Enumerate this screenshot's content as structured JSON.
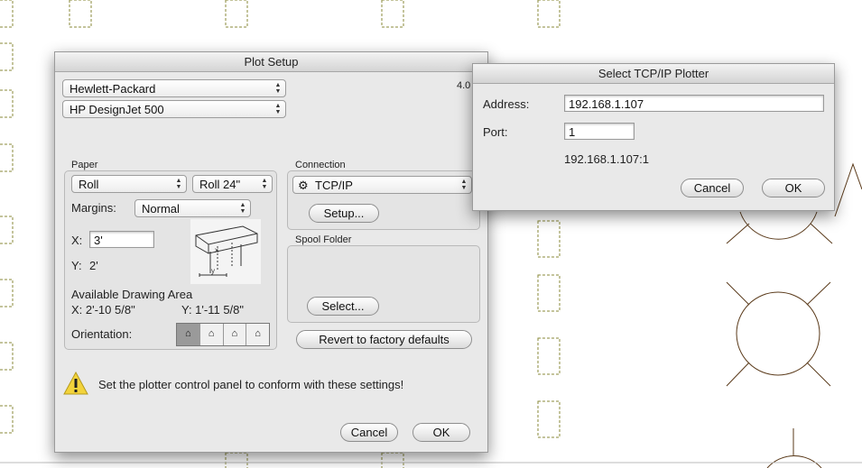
{
  "plot_setup": {
    "title": "Plot Setup",
    "manufacturer": "Hewlett-Packard",
    "model": "HP DesignJet 500",
    "version": "4.0",
    "paper": {
      "label": "Paper",
      "source": "Roll",
      "size": "Roll 24\"",
      "margins_label": "Margins:",
      "margins_value": "Normal",
      "x_label": "X:",
      "x_value": "3'",
      "y_label": "Y:",
      "y_value": "2'",
      "diagram_x": "x",
      "diagram_y": "y"
    },
    "drawing_area": {
      "label": "Available Drawing Area",
      "x": "X:  2'-10 5/8\"",
      "y": "Y:  1'-11 5/8\""
    },
    "orientation_label": "Orientation:",
    "connection": {
      "label": "Connection",
      "type": "TCP/IP",
      "setup_button": "Setup..."
    },
    "spool": {
      "label": "Spool Folder",
      "select_button": "Select..."
    },
    "revert_button": "Revert to factory defaults",
    "warning": "Set the plotter control panel to conform with these settings!",
    "cancel_button": "Cancel",
    "ok_button": "OK"
  },
  "tcpip_dialog": {
    "title": "Select TCP/IP Plotter",
    "address_label": "Address:",
    "address_value": "192.168.1.107",
    "port_label": "Port:",
    "port_value": "1",
    "summary": "192.168.1.107:1",
    "cancel_button": "Cancel",
    "ok_button": "OK"
  },
  "colors": {
    "cad_dash": "#8a8a3a",
    "cad_line": "#5a3a1a",
    "warning_yellow": "#f3d33b"
  }
}
